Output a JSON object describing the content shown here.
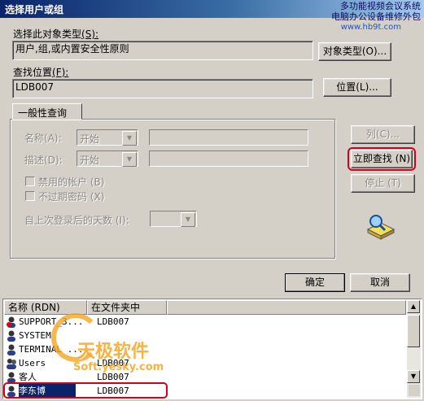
{
  "window": {
    "title": "选择用户或组"
  },
  "watermark": {
    "line1": "多功能视频会议系统",
    "line2": "电脑办公设备维修外包",
    "url": "www.hb9t.com",
    "logo_text": "天极软件",
    "logo_sub": "Soft.yesky.com"
  },
  "object_type": {
    "label": "选择此对象类型",
    "hotkey": "(S):",
    "value": "用户,组,或内置安全性原则",
    "button": "对象类型",
    "button_hotkey": "(O)..."
  },
  "location": {
    "label": "查找位置",
    "hotkey": "(F):",
    "value": "LDB007",
    "button": "位置",
    "button_hotkey": "(L)..."
  },
  "tab": {
    "label": "一般性查询"
  },
  "query": {
    "name_label": "名称",
    "name_hotkey": "(A):",
    "name_mode": "开始",
    "desc_label": "描述",
    "desc_hotkey": "(D):",
    "desc_mode": "开始",
    "disabled_accounts": "禁用的帐户",
    "disabled_accounts_hotkey": "(B)",
    "no_expire_pwd": "不过期密码",
    "no_expire_pwd_hotkey": "(X)",
    "days_since_login": "自上次登录后的天数",
    "days_since_login_hotkey": "(I):"
  },
  "buttons": {
    "columns": "列",
    "columns_hotkey": "(C)...",
    "find_now": "立即查找",
    "find_now_hotkey": "(N)",
    "stop": "停止",
    "stop_hotkey": "(T)",
    "ok": "确定",
    "cancel": "取消"
  },
  "results": {
    "col_name": "名称 (RDN)",
    "col_folder": "在文件夹中",
    "rows": [
      {
        "name": "SUPPORT_3...",
        "folder": "LDB007",
        "icon": "user-disabled-icon"
      },
      {
        "name": "SYSTEM",
        "folder": "",
        "icon": "user-icon"
      },
      {
        "name": "TERMINAL ...",
        "folder": "",
        "icon": "user-icon"
      },
      {
        "name": "Users",
        "folder": "LDB007",
        "icon": "group-icon"
      },
      {
        "name": "客人",
        "folder": "LDB007",
        "icon": "user-icon"
      },
      {
        "name": "李东博",
        "folder": "LDB007",
        "icon": "user-icon"
      }
    ],
    "selected_index": 5
  },
  "colors": {
    "highlight": "#0a246a",
    "annotation": "#d0021b"
  }
}
